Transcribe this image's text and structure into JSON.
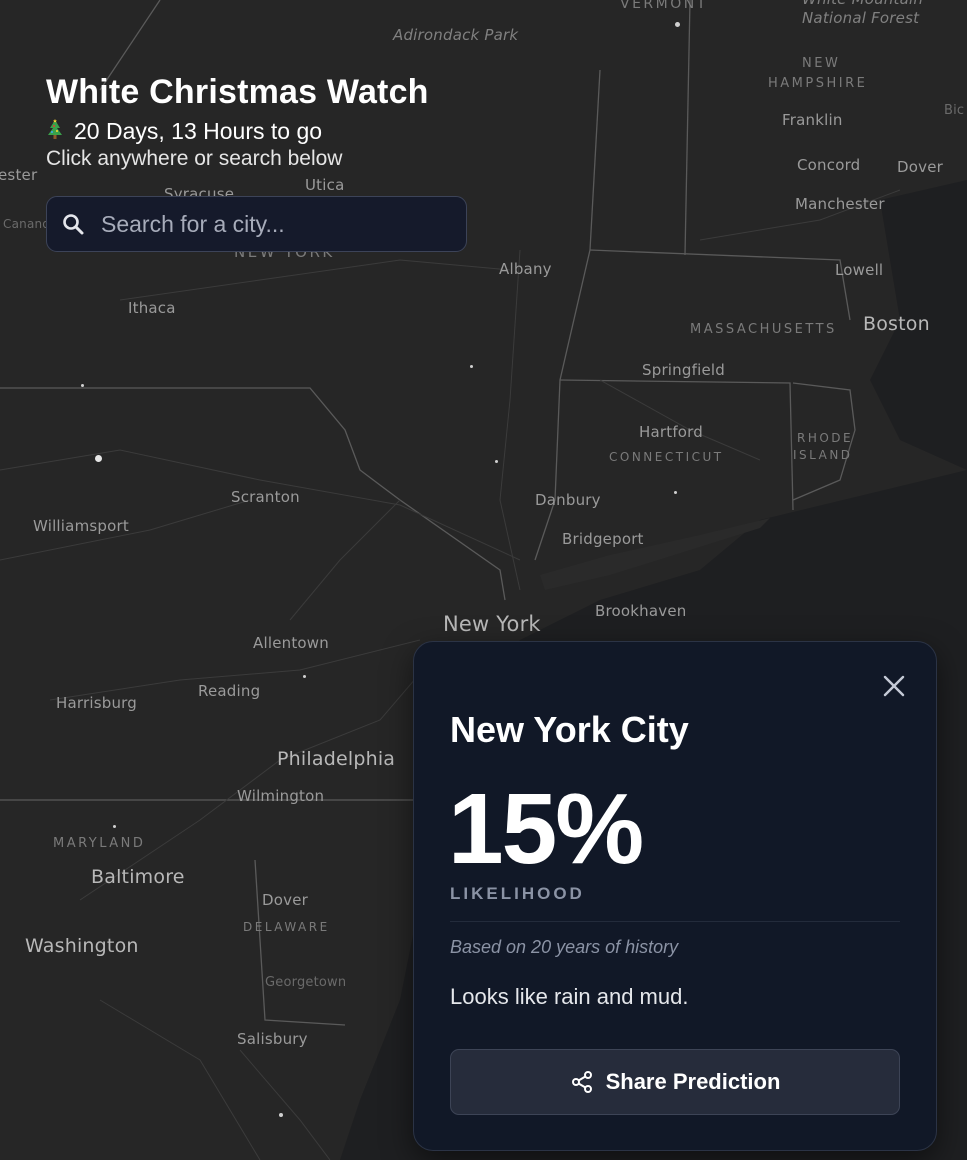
{
  "header": {
    "title": "White Christmas Watch",
    "countdown": "20 Days, 13 Hours to go",
    "hint": "Click anywhere or search below"
  },
  "search": {
    "placeholder": "Search for a city..."
  },
  "map": {
    "labels": {
      "vermont": "VERMONT",
      "white_mountain": "White Mountain",
      "national_forest": "National Forest",
      "adirondack": "Adirondack Park",
      "new_hampshire_1": "NEW",
      "new_hampshire_2": "HAMPSHIRE",
      "bic": "Bic",
      "franklin": "Franklin",
      "concord": "Concord",
      "dover_nh": "Dover",
      "manchester": "Manchester",
      "rochester": "ester",
      "syracuse": "Syracuse",
      "utica": "Utica",
      "canandaigua": "Canand",
      "new_york_state": "NEW YORK",
      "albany": "Albany",
      "lowell": "Lowell",
      "massachusetts": "MASSACHUSETTS",
      "boston": "Boston",
      "ithaca": "Ithaca",
      "springfield": "Springfield",
      "hartford": "Hartford",
      "connecticut": "CONNECTICUT",
      "rhode_1": "RHODE",
      "rhode_2": "ISLAND",
      "scranton": "Scranton",
      "williamsport": "Williamsport",
      "danbury": "Danbury",
      "bridgeport": "Bridgeport",
      "brookhaven": "Brookhaven",
      "new_york": "New York",
      "allentown": "Allentown",
      "reading": "Reading",
      "harrisburg": "Harrisburg",
      "philadelphia": "Philadelphia",
      "wilmington": "Wilmington",
      "maryland": "MARYLAND",
      "baltimore": "Baltimore",
      "dover_de": "Dover",
      "delaware": "DELAWARE",
      "washington": "Washington",
      "georgetown": "Georgetown",
      "salisbury": "Salisbury"
    }
  },
  "card": {
    "city": "New York City",
    "likelihood": "15%",
    "likelihood_label": "LIKELIHOOD",
    "history_note": "Based on 20 years of history",
    "verdict": "Looks like rain and mud.",
    "share_label": "Share Prediction"
  }
}
